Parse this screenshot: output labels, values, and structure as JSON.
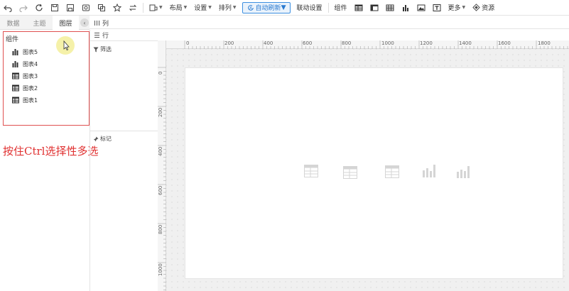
{
  "toolbar": {
    "icons": [
      "undo-icon",
      "redo-icon",
      "refresh-icon",
      "save-icon",
      "save-as-icon",
      "preview-icon",
      "export-icon",
      "favorite-icon",
      "transfer-icon"
    ],
    "menus": {
      "screen": "",
      "layout": "布局",
      "settings": "设置",
      "arrange": "排列",
      "auto_refresh": "自动刷新",
      "linkage": "联动设置",
      "components": "组件",
      "more": "更多",
      "resources": "资源"
    }
  },
  "tabs": [
    {
      "label": "数据"
    },
    {
      "label": "主题"
    },
    {
      "label": "图层"
    }
  ],
  "component_panel": {
    "title": "组件",
    "items": [
      {
        "label": "图表5",
        "icon": "bar-chart-icon"
      },
      {
        "label": "图表4",
        "icon": "bar-chart-icon"
      },
      {
        "label": "图表3",
        "icon": "table-icon"
      },
      {
        "label": "图表2",
        "icon": "table-icon"
      },
      {
        "label": "图表1",
        "icon": "table-icon"
      }
    ]
  },
  "hint": "按住Ctrl选择性多选",
  "shelves": {
    "columns": "列",
    "rows": "行",
    "filter": "筛选",
    "marks": "标记"
  },
  "ruler": {
    "top": [
      "0",
      "200",
      "400",
      "600",
      "800",
      "1000",
      "1200",
      "1400",
      "1600",
      "1800"
    ],
    "left": [
      "0",
      "200",
      "400",
      "600",
      "800",
      "1000"
    ]
  },
  "colors": {
    "accent": "#3c8fe0",
    "hint_red": "#e03030",
    "panel_border": "#e05050"
  }
}
